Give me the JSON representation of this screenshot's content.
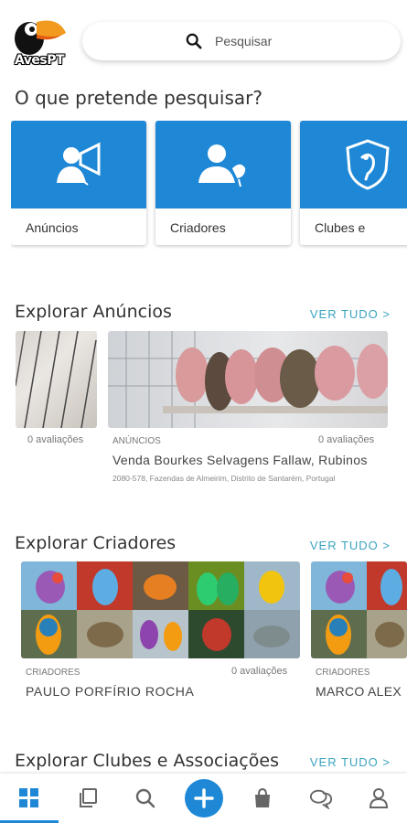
{
  "app": {
    "logo_text": "AvesPT"
  },
  "search": {
    "placeholder": "Pesquisar"
  },
  "question": "O que pretende pesquisar?",
  "categories": [
    {
      "label": "Anúncios",
      "icon": "megaphone-person-icon"
    },
    {
      "label": "Criadores",
      "icon": "person-bird-icon"
    },
    {
      "label": "Clubes e",
      "icon": "shield-bird-icon"
    }
  ],
  "sections": {
    "anuncios": {
      "title": "Explorar Anúncios",
      "see_all": "VER TUDO >",
      "cards": [
        {
          "ratings": "0 avaliações"
        },
        {
          "category": "ANÚNCIOS",
          "ratings": "0 avaliações",
          "title": "Venda  Bourkes Selvagens  Fallaw,  Rubinos",
          "address": "2080-578, Fazendas de Almeirim, Distrito de Santarém, Portugal"
        }
      ]
    },
    "criadores": {
      "title": "Explorar Criadores",
      "see_all": "VER TUDO >",
      "cards": [
        {
          "category": "CRIADORES",
          "ratings": "0 avaliações",
          "name": "PAULO  PORFÍRIO  ROCHA"
        },
        {
          "category": "CRIADORES",
          "name": "MARCO ALEX"
        }
      ]
    },
    "clubes": {
      "title": "Explorar Clubes e Associações",
      "see_all": "VER TUDO >"
    }
  },
  "nav": [
    {
      "icon": "grid-icon",
      "active": true
    },
    {
      "icon": "copy-icon"
    },
    {
      "icon": "search-icon"
    },
    {
      "icon": "plus-icon"
    },
    {
      "icon": "bag-icon"
    },
    {
      "icon": "chat-icon"
    },
    {
      "icon": "user-icon"
    }
  ],
  "colors": {
    "accent": "#1e88d6",
    "link": "#3aa3c0"
  }
}
